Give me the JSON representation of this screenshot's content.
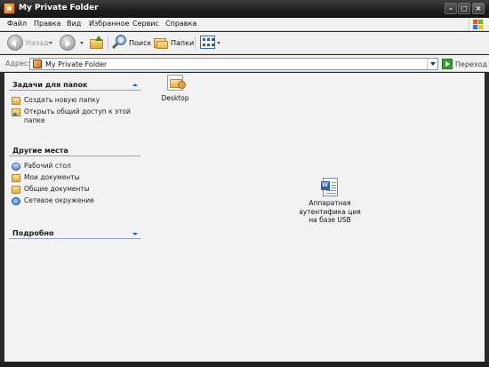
{
  "window": {
    "title": "My Private Folder"
  },
  "menubar": {
    "items": [
      "Файл",
      "Правка",
      "Вид",
      "Избранное",
      "Сервис",
      "Справка"
    ]
  },
  "toolbar": {
    "back_label": "Назад",
    "search_label": "Поиск",
    "folders_label": "Папки"
  },
  "address": {
    "label": "Адрес:",
    "value": "My Private Folder",
    "go_label": "Переход"
  },
  "taskpane": {
    "tasks": {
      "title": "Задачи для папок",
      "items": [
        "Создать новую папку",
        "Открыть общий доступ к этой папке"
      ]
    },
    "places": {
      "title": "Другие места",
      "items": [
        "Рабочий стол",
        "Мои документы",
        "Общие документы",
        "Сетевое окружение"
      ]
    },
    "details": {
      "title": "Подробно"
    }
  },
  "files": [
    {
      "name": "Desktop",
      "icon": "desktop-shortcut-icon"
    },
    {
      "name": "Аппаратная аутентифика ция на базе USB",
      "icon": "word-document-icon"
    }
  ],
  "colors": {
    "titlebar": "#1f1f1f",
    "content_bg": "#f2f2f2",
    "accent": "#2d5ba5"
  }
}
